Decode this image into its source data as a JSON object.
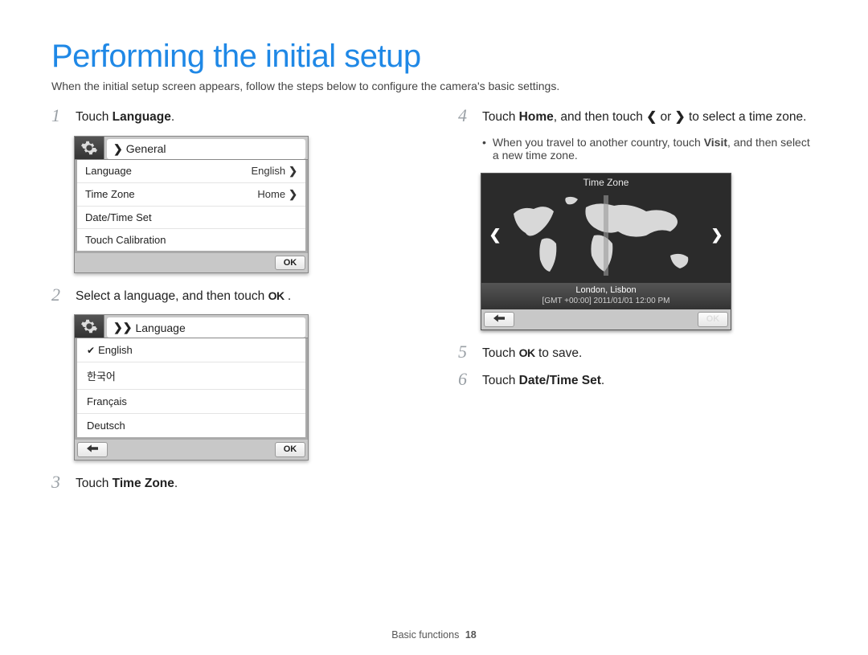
{
  "title": "Performing the initial setup",
  "intro": "When the initial setup screen appears, follow the steps below to configure the camera's basic settings.",
  "steps": {
    "s1_pre": "Touch ",
    "s1_bold": "Language",
    "s1_post": ".",
    "s2_pre": "Select a language, and then touch ",
    "s2_ok": "OK",
    "s2_post": " .",
    "s3_pre": "Touch ",
    "s3_bold": "Time Zone",
    "s3_post": ".",
    "s4_pre": "Touch ",
    "s4_bold": "Home",
    "s4_mid": ", and then touch ",
    "s4_or": " or ",
    "s4_post": " to select a time zone.",
    "s4_sub_pre": "When you travel to another country, touch ",
    "s4_sub_bold": "Visit",
    "s4_sub_post": ", and then select a new time zone.",
    "s5_pre": "Touch ",
    "s5_ok": "OK",
    "s5_post": " to save.",
    "s6_pre": "Touch ",
    "s6_bold": "Date/Time Set",
    "s6_post": "."
  },
  "panel_general": {
    "header": "General",
    "rows": [
      {
        "label": "Language",
        "value": "English"
      },
      {
        "label": "Time Zone",
        "value": "Home"
      },
      {
        "label": "Date/Time Set",
        "value": ""
      },
      {
        "label": "Touch Calibration",
        "value": ""
      }
    ],
    "ok": "OK"
  },
  "panel_language": {
    "header": "Language",
    "items": [
      "English",
      "한국어",
      "Français",
      "Deutsch"
    ],
    "checked_index": 0,
    "ok": "OK"
  },
  "panel_timezone": {
    "title": "Time Zone",
    "location": "London, Lisbon",
    "gmt_line": "[GMT +00:00] 2011/01/01 12:00 PM",
    "ok": "OK"
  },
  "footer": {
    "label": "Basic functions",
    "page": "18"
  }
}
